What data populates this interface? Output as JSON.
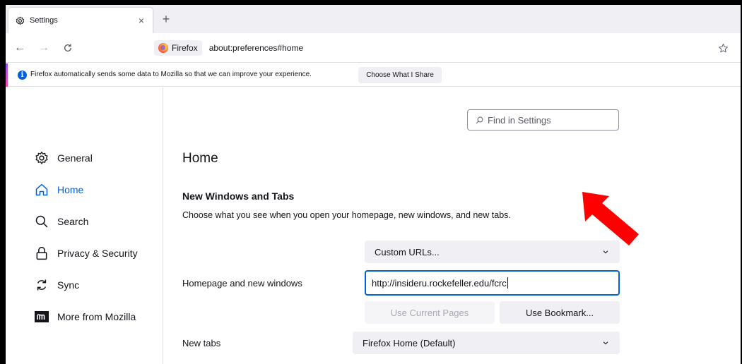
{
  "tab": {
    "title": "Settings",
    "icon": "gear-icon",
    "close": "×"
  },
  "new_tab": "+",
  "nav": {
    "back": "←",
    "forward": "→",
    "reload": "C",
    "identity_label": "Firefox",
    "url": "about:preferences#home"
  },
  "notification": {
    "info": "i",
    "text": "Firefox automatically sends some data to Mozilla so that we can improve your experience.",
    "button": "Choose What I Share"
  },
  "search": {
    "placeholder": "Find in Settings"
  },
  "sidebar": {
    "items": [
      {
        "label": "General",
        "icon": "gear-icon"
      },
      {
        "label": "Home",
        "icon": "home-icon",
        "selected": true
      },
      {
        "label": "Search",
        "icon": "search-icon"
      },
      {
        "label": "Privacy & Security",
        "icon": "lock-icon"
      },
      {
        "label": "Sync",
        "icon": "sync-icon"
      },
      {
        "label": "More from Mozilla",
        "icon": "mozilla-icon"
      }
    ]
  },
  "main": {
    "heading": "Home",
    "section_title": "New Windows and Tabs",
    "section_desc": "Choose what you see when you open your homepage, new windows, and new tabs.",
    "homepage_label": "Homepage and new windows",
    "homepage_select": "Custom URLs...",
    "homepage_url": "http://insideru.rockefeller.edu/fcrc",
    "use_current_pages": "Use Current Pages",
    "use_bookmark": "Use Bookmark...",
    "newtabs_label": "New tabs",
    "newtabs_select": "Firefox Home (Default)"
  },
  "colors": {
    "accent": "#0061e0",
    "annotation_arrow": "#ff0000"
  }
}
